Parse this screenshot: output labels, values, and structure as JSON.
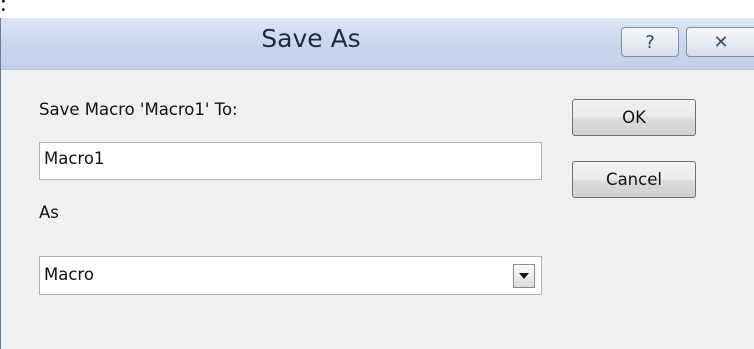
{
  "background_text": ":",
  "dialog": {
    "title": "Save As",
    "help_glyph": "?",
    "close_glyph": "✕",
    "save_label": "Save Macro 'Macro1' To:",
    "name_value": "Macro1",
    "as_label": "As",
    "as_selected": "Macro",
    "ok_label": "OK",
    "cancel_label": "Cancel",
    "icons": {
      "help": "help-icon",
      "close": "close-icon",
      "dropdown": "chevron-down-icon"
    },
    "colors": {
      "titlebar": "#c9d9ee",
      "dialog_bg": "#f0f0f0",
      "button_border": "#707070"
    }
  }
}
